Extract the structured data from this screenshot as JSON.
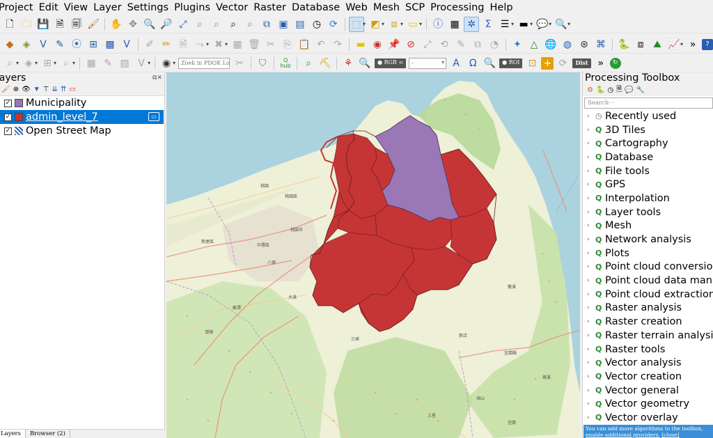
{
  "menubar": {
    "items": [
      "Project",
      "Edit",
      "View",
      "Layer",
      "Settings",
      "Plugins",
      "Vector",
      "Raster",
      "Database",
      "Web",
      "Mesh",
      "SCP",
      "Processing",
      "Help"
    ]
  },
  "toolbar": {
    "pdok_search_placeholder": "Zoek in PDOK Loc···",
    "rgb_label": "RGB =",
    "rgb_value": "-",
    "roi_label": "ROI",
    "dist_label": "Dist",
    "hub_label": "hub"
  },
  "layers_panel": {
    "title": "Layers",
    "layers": [
      {
        "name": "Municipality",
        "checked": true,
        "color": "#9a75b8"
      },
      {
        "name": "admin_level_7",
        "checked": true,
        "color": "#c93235"
      },
      {
        "name": "Open Street Map",
        "checked": true,
        "color": "raster-icon"
      }
    ]
  },
  "bottom_tabs": [
    "Layers",
    "Browser (2)"
  ],
  "map": {
    "fill_admin": "#c53535",
    "fill_municipality": "#9a78b5",
    "labels": [
      "桃園市",
      "桃園",
      "中壢區",
      "八德",
      "大溪",
      "新屋區",
      "桃園區",
      "三峽",
      "龍潭",
      "頂埔",
      "新店",
      "雙溪",
      "宜蘭縣",
      "礁溪",
      "頃山",
      "宜蘭",
      "三星"
    ]
  },
  "toolbox": {
    "title": "Processing Toolbox",
    "search_placeholder": "Search···",
    "categories": [
      "Recently used",
      "3D Tiles",
      "Cartography",
      "Database",
      "File tools",
      "GPS",
      "Interpolation",
      "Layer tools",
      "Mesh",
      "Network analysis",
      "Plots",
      "Point cloud conversion",
      "Point cloud data mana...",
      "Point cloud extraction",
      "Raster analysis",
      "Raster creation",
      "Raster terrain analysis",
      "Raster tools",
      "Vector analysis",
      "Vector creation",
      "Vector general",
      "Vector geometry",
      "Vector overlay"
    ],
    "notice_text": "You can add more algorithms to the toolbox, ",
    "notice_link": "enable additional providers.",
    "notice_close": "[close]"
  }
}
